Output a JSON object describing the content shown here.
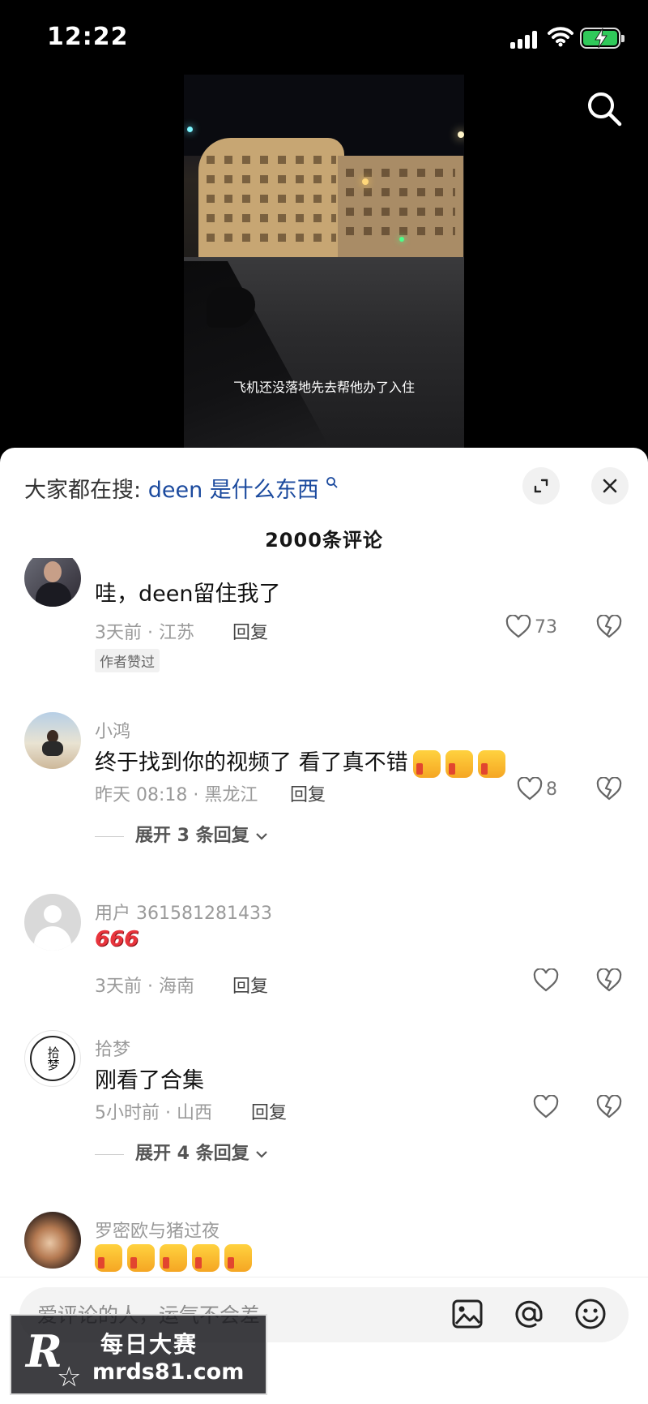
{
  "status_bar": {
    "time": "12:22"
  },
  "video": {
    "subtitle": "飞机还没落地先去帮他办了入住"
  },
  "sheet": {
    "search_prefix": "大家都在搜:",
    "search_keyword": "deen 是什么东西",
    "comment_count": "2000条评论"
  },
  "comments": [
    {
      "text": "哇，deen留住我了",
      "time_location": "3天前 · 江苏",
      "reply": "回复",
      "likes": "73",
      "author_tag": "作者赞过"
    },
    {
      "username": "小鸿",
      "text": "终于找到你的视频了 看了真不错",
      "time_location": "昨天 08:18 · 黑龙江",
      "reply": "回复",
      "likes": "8",
      "expand": "展开 3 条回复"
    },
    {
      "username": "用户 361581281433",
      "emoji_text": "666",
      "time_location": "3天前 · 海南",
      "reply": "回复"
    },
    {
      "username": "拾梦",
      "avatar_text": "拾梦",
      "text": "刚看了合集",
      "time_location": "5小时前 · 山西",
      "reply": "回复",
      "expand": "展开 4 条回复"
    },
    {
      "username": "罗密欧与猪过夜"
    }
  ],
  "input": {
    "placeholder": "爱评论的人，运气不会差"
  },
  "watermark": {
    "logo": "R",
    "title": "每日大赛",
    "domain": "mrds81.com"
  },
  "icons": {
    "search": "search-icon",
    "expand": "expand-icon",
    "close": "close-icon",
    "like": "heart-icon",
    "dislike": "broken-heart-icon",
    "image": "image-icon",
    "mention": "at-icon",
    "emoji": "emoji-icon"
  },
  "colors": {
    "accent_link": "#1b4a9e",
    "battery": "#30c95a"
  }
}
